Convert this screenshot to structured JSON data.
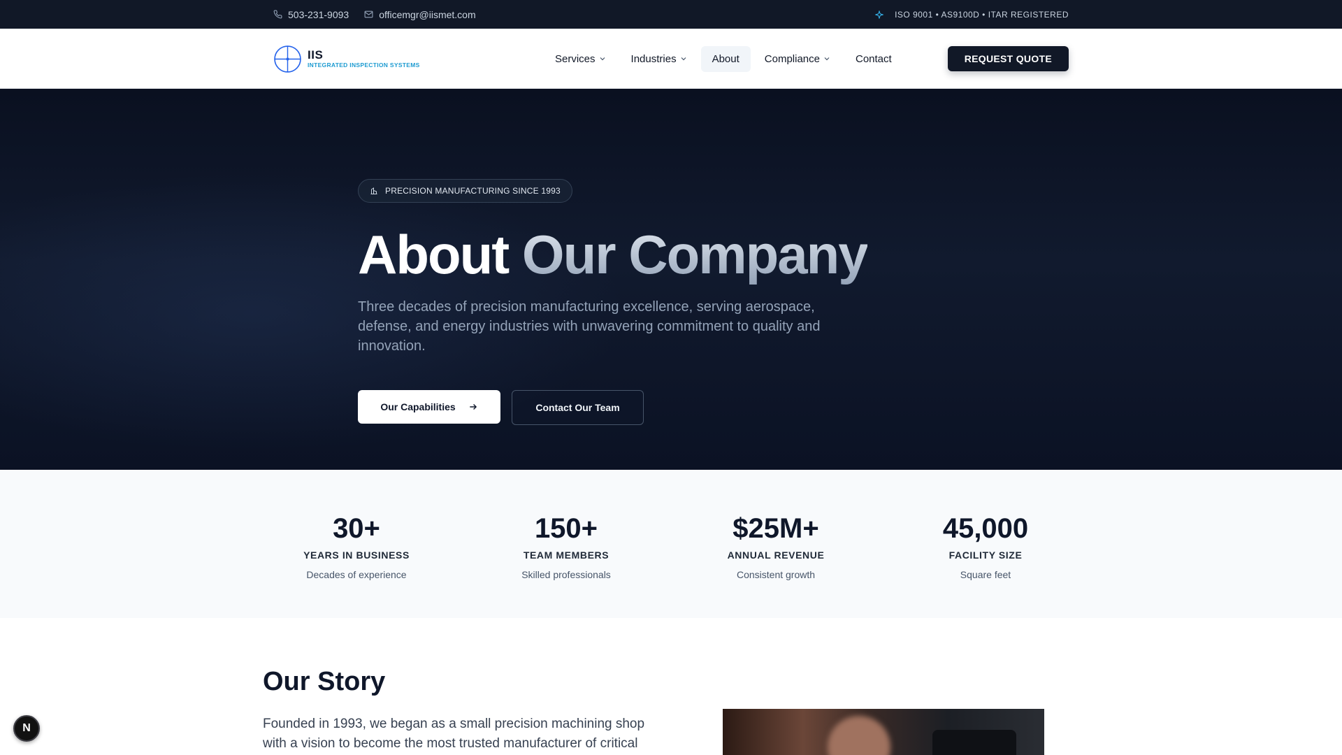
{
  "topbar": {
    "phone": "503-231-9093",
    "email": "officemgr@iismet.com",
    "certifications": "ISO 9001 • AS9100D • ITAR REGISTERED"
  },
  "header": {
    "logo_abbr": "IIS",
    "logo_full": "INTEGRATED INSPECTION SYSTEMS",
    "nav": [
      {
        "label": "Services",
        "dropdown": true
      },
      {
        "label": "Industries",
        "dropdown": true
      },
      {
        "label": "About",
        "dropdown": false,
        "active": true
      },
      {
        "label": "Compliance",
        "dropdown": true
      },
      {
        "label": "Contact",
        "dropdown": false
      }
    ],
    "cta_label": "REQUEST QUOTE"
  },
  "hero": {
    "badge": "PRECISION MANUFACTURING SINCE 1993",
    "title_part1": "About",
    "title_part2": "Our Company",
    "lead": "Three decades of precision manufacturing excellence, serving aerospace, defense, and energy industries with unwavering commitment to quality and innovation.",
    "primary_button": "Our Capabilities",
    "secondary_button": "Contact Our Team"
  },
  "stats": [
    {
      "value": "30+",
      "label": "YEARS IN BUSINESS",
      "sub": "Decades of experience"
    },
    {
      "value": "150+",
      "label": "TEAM MEMBERS",
      "sub": "Skilled professionals"
    },
    {
      "value": "$25M+",
      "label": "ANNUAL REVENUE",
      "sub": "Consistent growth"
    },
    {
      "value": "45,000",
      "label": "FACILITY SIZE",
      "sub": "Square feet"
    }
  ],
  "story": {
    "title": "Our Story",
    "text": "Founded in 1993, we began as a small precision machining shop with a vision to become the most trusted manufacturer of critical"
  },
  "dev_badge": "N",
  "colors": {
    "navy": "#111827",
    "hero_bg": "#0b1224",
    "accent_cyan": "#1d9bd1",
    "stats_bg": "#f8fafc"
  },
  "icons": {
    "phone": "phone-icon",
    "email": "mail-icon",
    "cert": "sparkle-icon",
    "badge": "building-icon",
    "arrow": "arrow-right-icon",
    "chevron": "chevron-down-icon"
  }
}
